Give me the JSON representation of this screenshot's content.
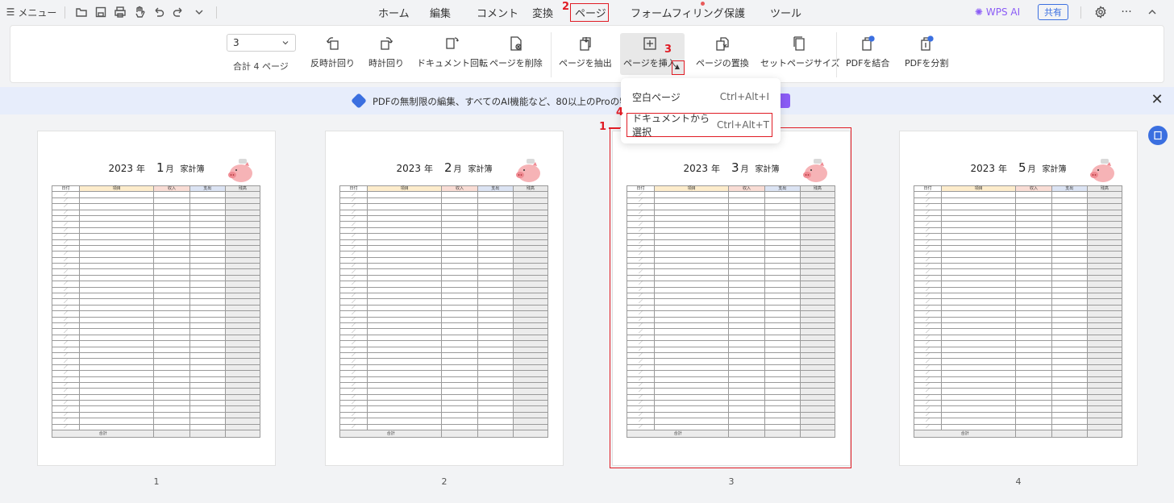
{
  "topbar": {
    "menu_label": "メニュー",
    "tabs": [
      "ホーム",
      "編集",
      "コメント",
      "変換",
      "ページ",
      "フォームフィリング",
      "保護",
      "ツール"
    ],
    "wps_ai": "WPS AI",
    "share": "共有",
    "more": "···"
  },
  "ribbon": {
    "page_select": "3",
    "total_pages": "合計 4 ページ",
    "buttons": [
      "反時計回り",
      "時計回り",
      "ドキュメント回転",
      "ページを削除",
      "ページを抽出",
      "ページを挿入",
      "ページの置換",
      "セットページサイズ",
      "PDFを結合",
      "PDFを分割"
    ]
  },
  "banner": {
    "text": "PDFの無制限の編集、すべてのAI機能など、80以上のProの特典"
  },
  "dropdown": {
    "items": [
      {
        "label": "空白ページ",
        "shortcut": "Ctrl+Alt+I"
      },
      {
        "label": "ドキュメントから選択",
        "shortcut": "Ctrl+Alt+T"
      }
    ]
  },
  "annotations": [
    "1",
    "2",
    "3",
    "4"
  ],
  "pages": [
    {
      "year": "2023",
      "year_unit": "年",
      "month": "1",
      "month_unit": "月",
      "title": "家計簿",
      "number": "1"
    },
    {
      "year": "2023",
      "year_unit": "年",
      "month": "2",
      "month_unit": "月",
      "title": "家計簿",
      "number": "2"
    },
    {
      "year": "2023",
      "year_unit": "年",
      "month": "3",
      "month_unit": "月",
      "title": "家計簿",
      "number": "3"
    },
    {
      "year": "2023",
      "year_unit": "年",
      "month": "5",
      "month_unit": "月",
      "title": "家計簿",
      "number": "4"
    }
  ],
  "sheet": {
    "headers": [
      "日付",
      "項目",
      "収入",
      "支出",
      "残高"
    ],
    "header_colors": [
      "#ffffff",
      "#fdeccb",
      "#f9dcd4",
      "#dbe3f3",
      "#e8e8e8"
    ],
    "row_mark": "／",
    "total_label": "合計"
  },
  "colors": {
    "accent": "#e01b24",
    "link": "#3b6fe0",
    "ai": "#8b5cf6"
  }
}
